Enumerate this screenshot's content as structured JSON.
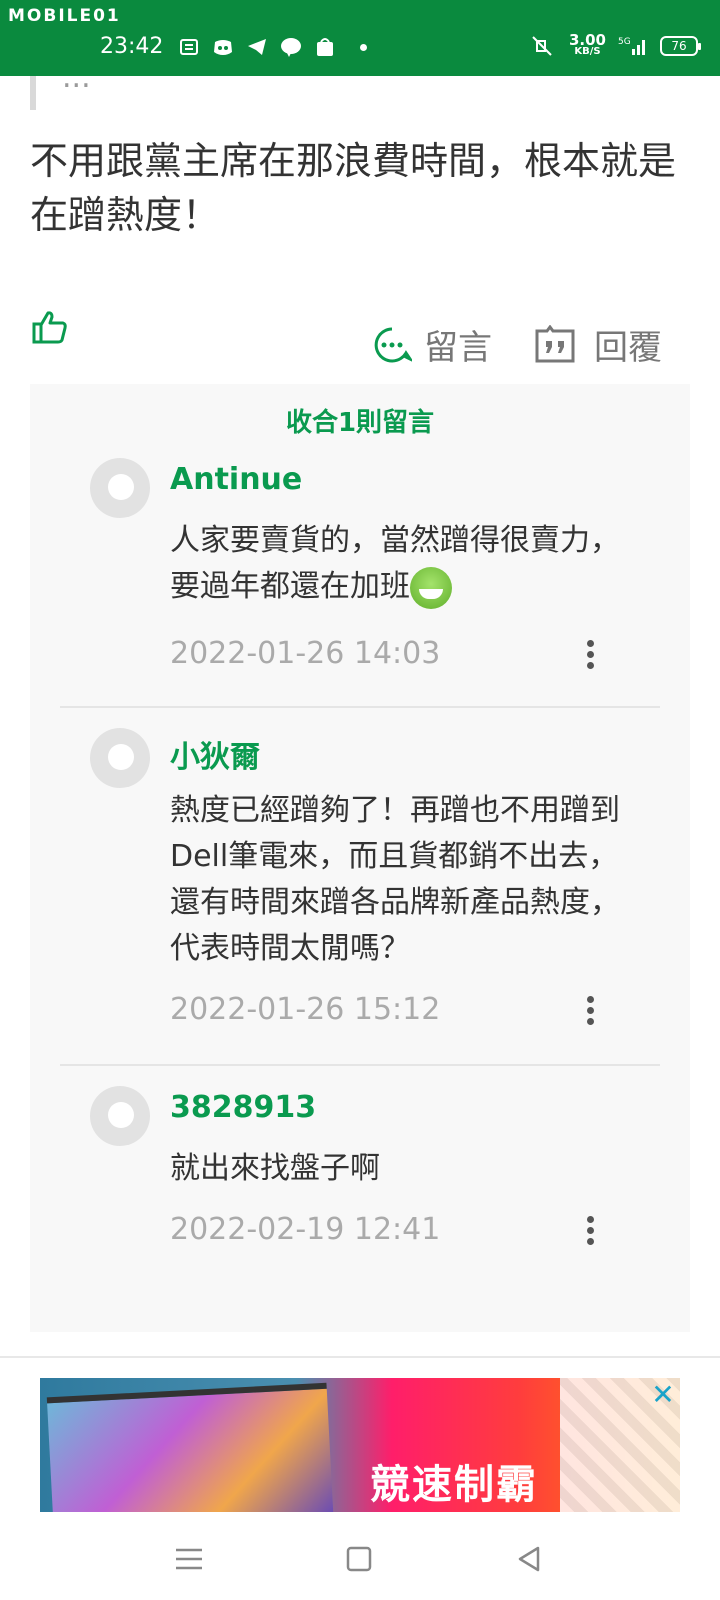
{
  "status_bar": {
    "brand": "MOBILE01",
    "time": "23:42",
    "speed_value": "3.00",
    "speed_unit": "KB/S",
    "network": "5G",
    "battery": "76",
    "icons": [
      "news-icon",
      "discord-icon",
      "telegram-icon",
      "line-icon",
      "shopee-icon",
      "dot-icon",
      "mute-icon",
      "signal-icon"
    ]
  },
  "post": {
    "quote_fragment": "...",
    "body": "不用跟黨主席在那浪費時間，根本就是在蹭熱度！"
  },
  "actions": {
    "comment_label": "留言",
    "reply_label": "回覆"
  },
  "comments_panel": {
    "collapse_label": "收合1則留言",
    "comments": [
      {
        "user": "Antinue",
        "text": "人家要賣貨的，當然蹭得很賣力，要過年都還在加班",
        "time": "2022-01-26 14:03",
        "emoji": "grinning-devil-emoji"
      },
      {
        "user": "小狄爾",
        "text": "熱度已經蹭夠了！再蹭也不用蹭到Dell筆電來，而且貨都銷不出去，還有時間來蹭各品牌新產品熱度，代表時間太閒嗎？",
        "time": "2022-01-26 15:12"
      },
      {
        "user": "3828913",
        "text": "就出來找盤子啊",
        "time": "2022-02-19 12:41"
      }
    ]
  },
  "ad": {
    "title": "競速制霸",
    "close_label": "✕"
  },
  "colors": {
    "brand_green": "#0a8a3e",
    "accent_green": "#0a9a4f",
    "muted_gray": "#aaaaaa"
  }
}
